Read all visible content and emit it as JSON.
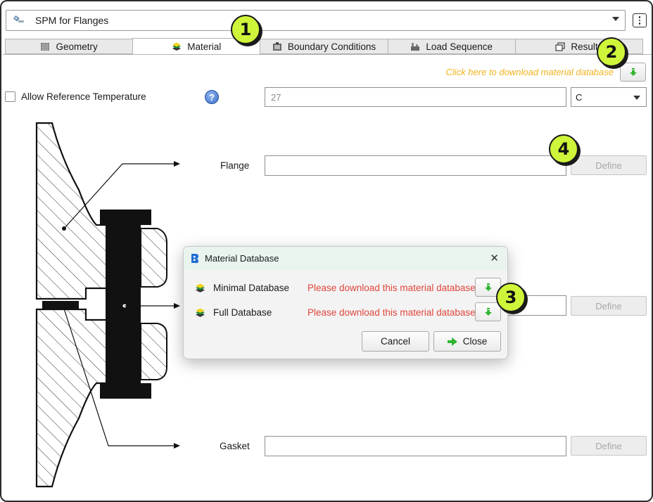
{
  "module": {
    "title": "SPM for Flanges"
  },
  "tabs": [
    {
      "label": "Geometry",
      "icon": "geometry-icon"
    },
    {
      "label": "Material",
      "icon": "material-layers-icon"
    },
    {
      "label": "Boundary Conditions",
      "icon": "boundary-conditions-icon"
    },
    {
      "label": "Load Sequence",
      "icon": "load-sequence-icon"
    },
    {
      "label": "Results",
      "icon": "results-icon"
    }
  ],
  "download_link": "Click here to download material database",
  "reference_temperature": {
    "checkbox_label": "Allow Reference Temperature",
    "checked": false,
    "value": "27",
    "unit": "C"
  },
  "parts": {
    "flange": {
      "label": "Flange",
      "define": "Define"
    },
    "bolt": {
      "define": "Define"
    },
    "gasket": {
      "label": "Gasket",
      "define": "Define"
    }
  },
  "dialog": {
    "title": "Material Database",
    "databases": [
      {
        "name": "Minimal Database",
        "status": "Please download this material database"
      },
      {
        "name": "Full Database",
        "status": "Please download this material database"
      }
    ],
    "cancel": "Cancel",
    "close": "Close"
  },
  "callouts": [
    "1",
    "2",
    "3",
    "4"
  ],
  "colors": {
    "accent_callout": "#cff53a",
    "link_yellow": "#f0b41e",
    "status_red": "#e0463c",
    "download_green": "#2fb52f"
  }
}
